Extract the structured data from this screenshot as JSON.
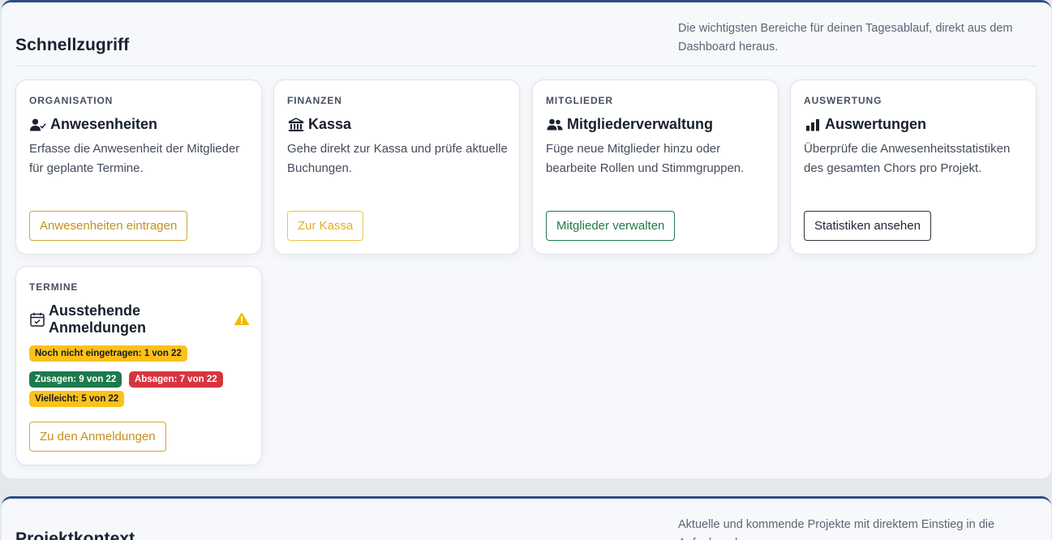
{
  "quick_access": {
    "title": "Schnellzugriff",
    "description": "Die wichtigsten Bereiche für deinen Tagesablauf, direkt aus dem Dashboard heraus.",
    "cards": [
      {
        "category": "ORGANISATION",
        "icon": "user-check-icon",
        "title": "Anwesenheiten",
        "text": "Erfasse die Anwesenheit der Mitglieder für geplante Termine.",
        "button": "Anwesenheiten eintragen"
      },
      {
        "category": "FINANZEN",
        "icon": "bank-icon",
        "title": "Kassa",
        "text": "Gehe direkt zur Kassa und prüfe aktuelle Buchungen.",
        "button": "Zur Kassa"
      },
      {
        "category": "MITGLIEDER",
        "icon": "users-icon",
        "title": "Mitgliederverwaltung",
        "text": "Füge neue Mitglieder hinzu oder bearbeite Rollen und Stimmgruppen.",
        "button": "Mitglieder verwalten"
      },
      {
        "category": "AUSWERTUNG",
        "icon": "bar-chart-icon",
        "title": "Auswertungen",
        "text": "Überprüfe die Anwesenheitsstatistiken des gesamten Chors pro Projekt.",
        "button": "Statistiken ansehen"
      },
      {
        "category": "TERMINE",
        "icon": "calendar-check-icon",
        "title": "Ausstehende Anmeldungen",
        "status_icon": "warning-icon",
        "badges": {
          "not_entered": "Noch nicht eingetragen: 1 von 22",
          "yes": "Zusagen: 9 von 22",
          "no": "Absagen: 7 von 22",
          "maybe": "Vielleicht: 5 von 22"
        },
        "button": "Zu den Anmeldungen"
      }
    ]
  },
  "project_context": {
    "title": "Projektkontext",
    "description": "Aktuelle und kommende Projekte mit direktem Einstieg in die Aufgabenplanung."
  },
  "colors": {
    "accent": "#2b4f83",
    "amber": "#d4a436",
    "yellow": "#fbc21c",
    "green": "#1c7a4b",
    "red": "#d8343f"
  }
}
